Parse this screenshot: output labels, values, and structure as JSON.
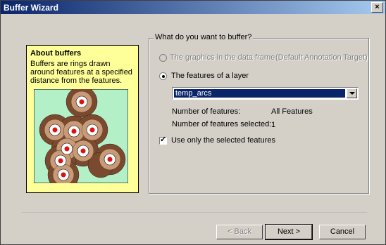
{
  "window": {
    "title": "Buffer Wizard",
    "close_label": "×"
  },
  "info": {
    "title": "About buffers",
    "text": "Buffers are rings drawn around features at a specified distance from the features."
  },
  "group": {
    "label": "What do you want to buffer?",
    "option_graphics": "The graphics in the data frame",
    "option_graphics_note": "(Default Annotation Target)",
    "option_features": "The features of a layer",
    "layer_selected": "temp_arcs",
    "num_features_label": "Number of features:",
    "num_features_value": "All Features",
    "num_selected_label": "Number of features selected:",
    "num_selected_value": "1",
    "use_selected_label": "Use only the selected features"
  },
  "buttons": {
    "back": "< Back",
    "next": "Next >",
    "cancel": "Cancel"
  },
  "colors": {
    "title_start": "#0a246a",
    "title_end": "#a6caf0",
    "panel_bg": "#ffff99",
    "dialog_bg": "#d4d0c8",
    "selection": "#0a246a"
  },
  "icons": {
    "close": "close-icon",
    "dropdown": "chevron-down-icon",
    "check": "checkmark-icon"
  }
}
